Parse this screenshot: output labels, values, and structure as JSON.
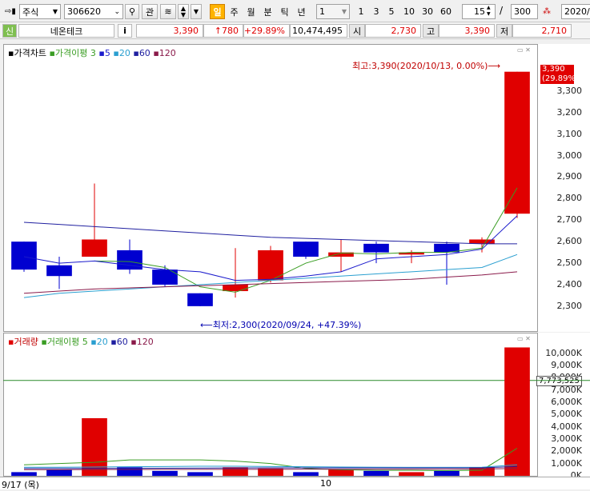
{
  "toolbar": {
    "market_type": "주식",
    "stock_code": "306620",
    "btn_relation": "관",
    "period_buttons": [
      "일",
      "주",
      "월",
      "분",
      "틱",
      "년"
    ],
    "active_period": "일",
    "minute_select": "1",
    "minute_buttons": [
      "1",
      "3",
      "5",
      "10",
      "30",
      "60"
    ],
    "count_value": "15",
    "total_count": "300",
    "date_field": "2020/"
  },
  "quote": {
    "sin_tag": "신",
    "stock_name": "네온테크",
    "info_btn": "i",
    "price": "3,390",
    "change": "↑780",
    "change_pct": "+29.89%",
    "volume": "10,474,495",
    "open_label": "시",
    "open": "2,730",
    "high_label": "고",
    "high": "3,390",
    "low_label": "저",
    "low": "2,710"
  },
  "price_panel": {
    "legend_title": "가격차트",
    "legend_ma": "가격이평",
    "ma_periods": [
      {
        "label": "3",
        "color": "#3a9d23"
      },
      {
        "label": "5",
        "color": "#1a1acc"
      },
      {
        "label": "20",
        "color": "#2a9fd0"
      },
      {
        "label": "60",
        "color": "#2020a0"
      },
      {
        "label": "120",
        "color": "#8a1a4a"
      }
    ],
    "high_note": "최고:3,390(2020/10/13, 0.00%)⟶",
    "low_note": "⟵최저:2,300(2020/09/24, +47.39%)",
    "price_badge_value": "3,390",
    "price_badge_pct": "(29.89%)",
    "y_ticks": [
      "3,300",
      "3,200",
      "3,100",
      "3,000",
      "2,900",
      "2,800",
      "2,700",
      "2,600",
      "2,500",
      "2,400",
      "2,300"
    ]
  },
  "volume_panel": {
    "legend_title": "거래량",
    "legend_ma": "거래이평",
    "ma_periods": [
      {
        "label": "5",
        "color": "#3a9d23"
      },
      {
        "label": "20",
        "color": "#2a9fd0"
      },
      {
        "label": "60",
        "color": "#2020a0"
      },
      {
        "label": "120",
        "color": "#8a1a4a"
      }
    ],
    "current_volume_badge": "7,773,525",
    "y_ticks": [
      "10,000K",
      "9,000K",
      "8,000K",
      "7,000K",
      "6,000K",
      "5,000K",
      "4,000K",
      "3,000K",
      "2,000K",
      "1,000K",
      "0K"
    ]
  },
  "x_axis": {
    "start_label": "9/17 (목)",
    "mid_label": "10"
  },
  "chart_data": {
    "type": "candlestick",
    "price_ylim": [
      2240,
      3400
    ],
    "volume_ylim": [
      0,
      10500
    ],
    "candles": [
      {
        "o": 2600,
        "c": 2470,
        "h": 2600,
        "l": 2460,
        "v": 300
      },
      {
        "o": 2490,
        "c": 2440,
        "h": 2530,
        "l": 2380,
        "v": 500
      },
      {
        "o": 2530,
        "c": 2610,
        "h": 2870,
        "l": 2530,
        "v": 4700
      },
      {
        "o": 2560,
        "c": 2470,
        "h": 2610,
        "l": 2450,
        "v": 700
      },
      {
        "o": 2470,
        "c": 2400,
        "h": 2490,
        "l": 2390,
        "v": 400
      },
      {
        "o": 2360,
        "c": 2300,
        "h": 2360,
        "l": 2300,
        "v": 300
      },
      {
        "o": 2370,
        "c": 2400,
        "h": 2570,
        "l": 2340,
        "v": 700
      },
      {
        "o": 2420,
        "c": 2560,
        "h": 2580,
        "l": 2410,
        "v": 600
      },
      {
        "o": 2600,
        "c": 2530,
        "h": 2600,
        "l": 2520,
        "v": 300
      },
      {
        "o": 2530,
        "c": 2550,
        "h": 2610,
        "l": 2460,
        "v": 500
      },
      {
        "o": 2590,
        "c": 2550,
        "h": 2600,
        "l": 2500,
        "v": 400
      },
      {
        "o": 2540,
        "c": 2550,
        "h": 2560,
        "l": 2500,
        "v": 300
      },
      {
        "o": 2590,
        "c": 2550,
        "h": 2600,
        "l": 2400,
        "v": 400
      },
      {
        "o": 2590,
        "c": 2610,
        "h": 2620,
        "l": 2550,
        "v": 700
      },
      {
        "o": 2730,
        "c": 3390,
        "h": 3390,
        "l": 2710,
        "v": 10470
      }
    ],
    "ma_lines": [
      {
        "name": "3",
        "color": "#3a9d23",
        "values": [
          null,
          null,
          2510,
          2507,
          2480,
          2390,
          2365,
          2420,
          2500,
          2547,
          2543,
          2550,
          2550,
          2570,
          2850
        ]
      },
      {
        "name": "5",
        "color": "#1a1acc",
        "values": [
          2530,
          2500,
          2510,
          2490,
          2470,
          2460,
          2420,
          2425,
          2440,
          2460,
          2520,
          2530,
          2540,
          2565,
          2720
        ]
      },
      {
        "name": "20",
        "color": "#2a9fd0",
        "values": [
          2340,
          2360,
          2370,
          2380,
          2390,
          2400,
          2410,
          2420,
          2430,
          2440,
          2450,
          2460,
          2470,
          2480,
          2540
        ]
      },
      {
        "name": "60",
        "color": "#2020a0",
        "values": [
          2690,
          2680,
          2670,
          2660,
          2650,
          2640,
          2630,
          2620,
          2615,
          2610,
          2605,
          2600,
          2595,
          2590,
          2590
        ]
      },
      {
        "name": "120",
        "color": "#8a1a4a",
        "values": [
          2360,
          2370,
          2380,
          2385,
          2390,
          2395,
          2400,
          2405,
          2410,
          2415,
          2420,
          2425,
          2435,
          2445,
          2460
        ]
      }
    ],
    "volume_ma_lines": [
      {
        "name": "5",
        "color": "#3a9d23",
        "values": [
          900,
          1000,
          1100,
          1300,
          1300,
          1300,
          1200,
          1000,
          600,
          500,
          450,
          450,
          420,
          460,
          2250
        ]
      },
      {
        "name": "20",
        "color": "#2a9fd0",
        "values": [
          700,
          700,
          720,
          740,
          760,
          780,
          780,
          760,
          740,
          720,
          700,
          690,
          690,
          700,
          900
        ]
      },
      {
        "name": "60",
        "color": "#2020a0",
        "values": [
          600,
          600,
          600,
          610,
          620,
          630,
          640,
          650,
          650,
          650,
          650,
          650,
          650,
          660,
          760
        ]
      },
      {
        "name": "120",
        "color": "#8a1a4a",
        "values": [
          500,
          500,
          510,
          510,
          520,
          520,
          530,
          530,
          540,
          540,
          540,
          545,
          550,
          560,
          600
        ]
      }
    ],
    "volume_reference_line": 7773.525
  }
}
